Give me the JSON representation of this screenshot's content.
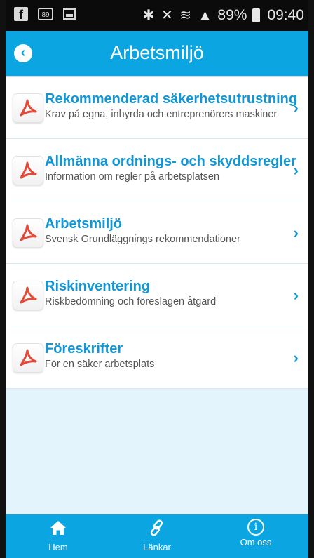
{
  "status_bar": {
    "battery": "89%",
    "time": "09:40",
    "cal_day": "89"
  },
  "header": {
    "title": "Arbetsmiljö"
  },
  "items": [
    {
      "title": "Rekommenderad säkerhetsutrustning",
      "subtitle": "Krav på egna, inhyrda och entreprenörers maskiner"
    },
    {
      "title": "Allmänna ordnings- och skyddsregler",
      "subtitle": "Information om regler på arbetsplatsen"
    },
    {
      "title": "Arbetsmiljö",
      "subtitle": "Svensk Grundläggnings rekommendationer"
    },
    {
      "title": "Riskinventering",
      "subtitle": "Riskbedömning och föreslagen åtgärd"
    },
    {
      "title": "Föreskrifter",
      "subtitle": "För en säker arbetsplats"
    }
  ],
  "tabs": {
    "home": "Hem",
    "links": "Länkar",
    "about": "Om oss"
  },
  "colors": {
    "accent": "#0ba5e2",
    "link": "#1296d5",
    "background": "#e3f4fc",
    "pdf": "#e24a3a"
  }
}
